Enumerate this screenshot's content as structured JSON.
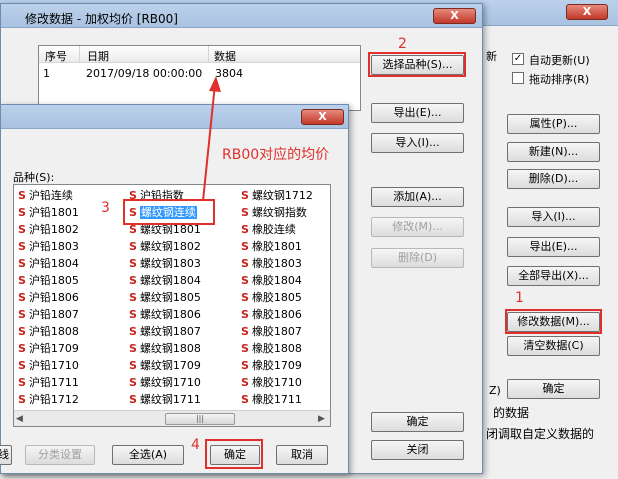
{
  "main_window": {
    "side_label_1": "目",
    "side_label_2": "新",
    "auto_update": {
      "label": "自动更新(U)",
      "checked": true
    },
    "drag_sort": {
      "label": "拖动排序(R)",
      "checked": false
    },
    "buttons": {
      "properties": "属性(P)...",
      "new": "新建(N)...",
      "delete": "删除(D)...",
      "import": "导入(I)...",
      "export": "导出(E)...",
      "export_all": "全部导出(X)...",
      "modify_data": "修改数据(M)...",
      "clear_data": "清空数据(C)",
      "confirm": "确定"
    },
    "partial_text_1": "Z)",
    "partial_text_2": "的数据",
    "partial_text_3": "闭调取自定义数据的"
  },
  "modify_dialog": {
    "title": "修改数据 - 加权均价 [RB00]",
    "close_label": "X",
    "table": {
      "headers": [
        "序号",
        "日期",
        "数据"
      ],
      "rows": [
        {
          "index": "1",
          "date": "2017/09/18 00:00:00",
          "value": "3804"
        }
      ]
    },
    "buttons": {
      "select_variety": "选择品种(S)...",
      "export": "导出(E)...",
      "import": "导入(I)...",
      "add": "添加(A)...",
      "modify": "修改(M)...",
      "delete": "删除(D)",
      "confirm": "确定",
      "close": "关闭"
    }
  },
  "variety_dialog": {
    "close_label": "X",
    "label": "品种(S):",
    "col1": [
      "沪铅连续",
      "沪铅1801",
      "沪铅1802",
      "沪铅1803",
      "沪铅1804",
      "沪铅1805",
      "沪铅1806",
      "沪铅1807",
      "沪铅1808",
      "沪铅1709",
      "沪铅1710",
      "沪铅1711",
      "沪铅1712"
    ],
    "col2": [
      "沪铅指数",
      "螺纹钢连续",
      "螺纹钢1801",
      "螺纹钢1802",
      "螺纹钢1803",
      "螺纹钢1804",
      "螺纹钢1805",
      "螺纹钢1806",
      "螺纹钢1807",
      "螺纹钢1808",
      "螺纹钢1709",
      "螺纹钢1710",
      "螺纹钢1711"
    ],
    "col3": [
      "螺纹钢1712",
      "螺纹钢指数",
      "橡胶连续",
      "橡胶1801",
      "橡胶1803",
      "橡胶1804",
      "橡胶1805",
      "橡胶1806",
      "橡胶1807",
      "橡胶1808",
      "橡胶1709",
      "橡胶1710",
      "橡胶1711"
    ],
    "item_prefix": "S",
    "scroll_thumb": "|||",
    "buttons": {
      "partial": "线",
      "category_settings": "分类设置",
      "select_all": "全选(A)",
      "confirm": "确定",
      "cancel": "取消"
    }
  },
  "annotations": {
    "step1": "1",
    "step2": "2",
    "step3": "3",
    "step4": "4",
    "callout": "RB00对应的均价"
  },
  "colors": {
    "accent_red": "#e0302c",
    "selection_blue": "#3399ff"
  }
}
